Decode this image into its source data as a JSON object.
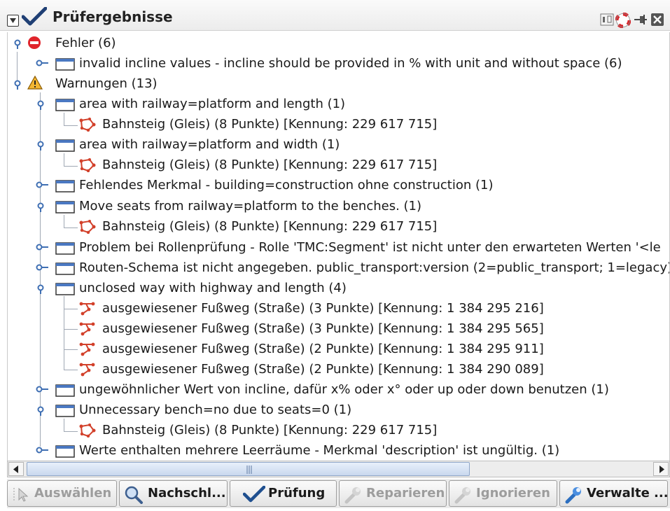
{
  "panel": {
    "title": "Prüfergebnisse",
    "collapse_icon": "collapse-icon",
    "tools": [
      "toggle-dialog-icon",
      "help-icon",
      "pin-icon",
      "close-icon"
    ]
  },
  "tree": {
    "errors": {
      "label": "Fehler (6)",
      "icon": "error-icon",
      "groups": [
        {
          "label": "invalid incline values - incline should be provided in % with unit and without space (6)"
        }
      ]
    },
    "warnings": {
      "label": "Warnungen (13)",
      "icon": "warning-icon",
      "groups": [
        {
          "label": "area with railway=platform and length (1)",
          "children": [
            "Bahnsteig (Gleis) (8 Punkte) [Kennung: 229 617 715]"
          ]
        },
        {
          "label": "area with railway=platform and width (1)",
          "children": [
            "Bahnsteig (Gleis) (8 Punkte) [Kennung: 229 617 715]"
          ]
        },
        {
          "label": "Fehlendes Merkmal - building=construction ohne construction (1)"
        },
        {
          "label": "Move seats from railway=platform to the benches. (1)",
          "children": [
            "Bahnsteig (Gleis) (8 Punkte) [Kennung: 229 617 715]"
          ]
        },
        {
          "label": "Problem bei Rollenprüfung - Rolle 'TMC:Segment' ist nicht unter den erwarteten Werten '<le"
        },
        {
          "label": "Routen-Schema ist nicht angegeben. public_transport:version (2=public_transport; 1=legacy)"
        },
        {
          "label": "unclosed way with highway and length (4)",
          "children": [
            "ausgewiesener Fußweg (Straße) (3 Punkte) [Kennung: 1 384 295 216]",
            "ausgewiesener Fußweg (Straße) (3 Punkte) [Kennung: 1 384 295 565]",
            "ausgewiesener Fußweg (Straße) (2 Punkte) [Kennung: 1 384 295 911]",
            "ausgewiesener Fußweg (Straße) (2 Punkte) [Kennung: 1 384 290 089]"
          ]
        },
        {
          "label": "ungewöhnlicher Wert von incline, dafür x% oder x° oder up oder down benutzen (1)"
        },
        {
          "label": "Unnecessary bench=no due to seats=0 (1)",
          "children": [
            "Bahnsteig (Gleis) (8 Punkte) [Kennung: 229 617 715]"
          ]
        },
        {
          "label": "Werte enthalten mehrere Leerräume - Merkmal 'description' ist ungültig. (1)"
        }
      ]
    }
  },
  "scrollbar": {
    "position_fraction": 0.0,
    "visible_fraction": 0.68
  },
  "buttons": [
    {
      "label": "Auswählen",
      "icon": "select-icon",
      "enabled": false
    },
    {
      "label": "Nachschl...",
      "icon": "zoom-icon",
      "enabled": true
    },
    {
      "label": "Prüfung",
      "icon": "check-icon",
      "enabled": true
    },
    {
      "label": "Reparieren",
      "icon": "wrench-icon",
      "enabled": false
    },
    {
      "label": "Ignorieren",
      "icon": "wrench-icon",
      "enabled": false
    },
    {
      "label": "Verwalte ...",
      "icon": "wrench-icon",
      "enabled": true
    }
  ],
  "colors": {
    "accent": "#4a78c2",
    "error": "#e0242b",
    "warning": "#e8a317",
    "way": "#d2402a"
  }
}
